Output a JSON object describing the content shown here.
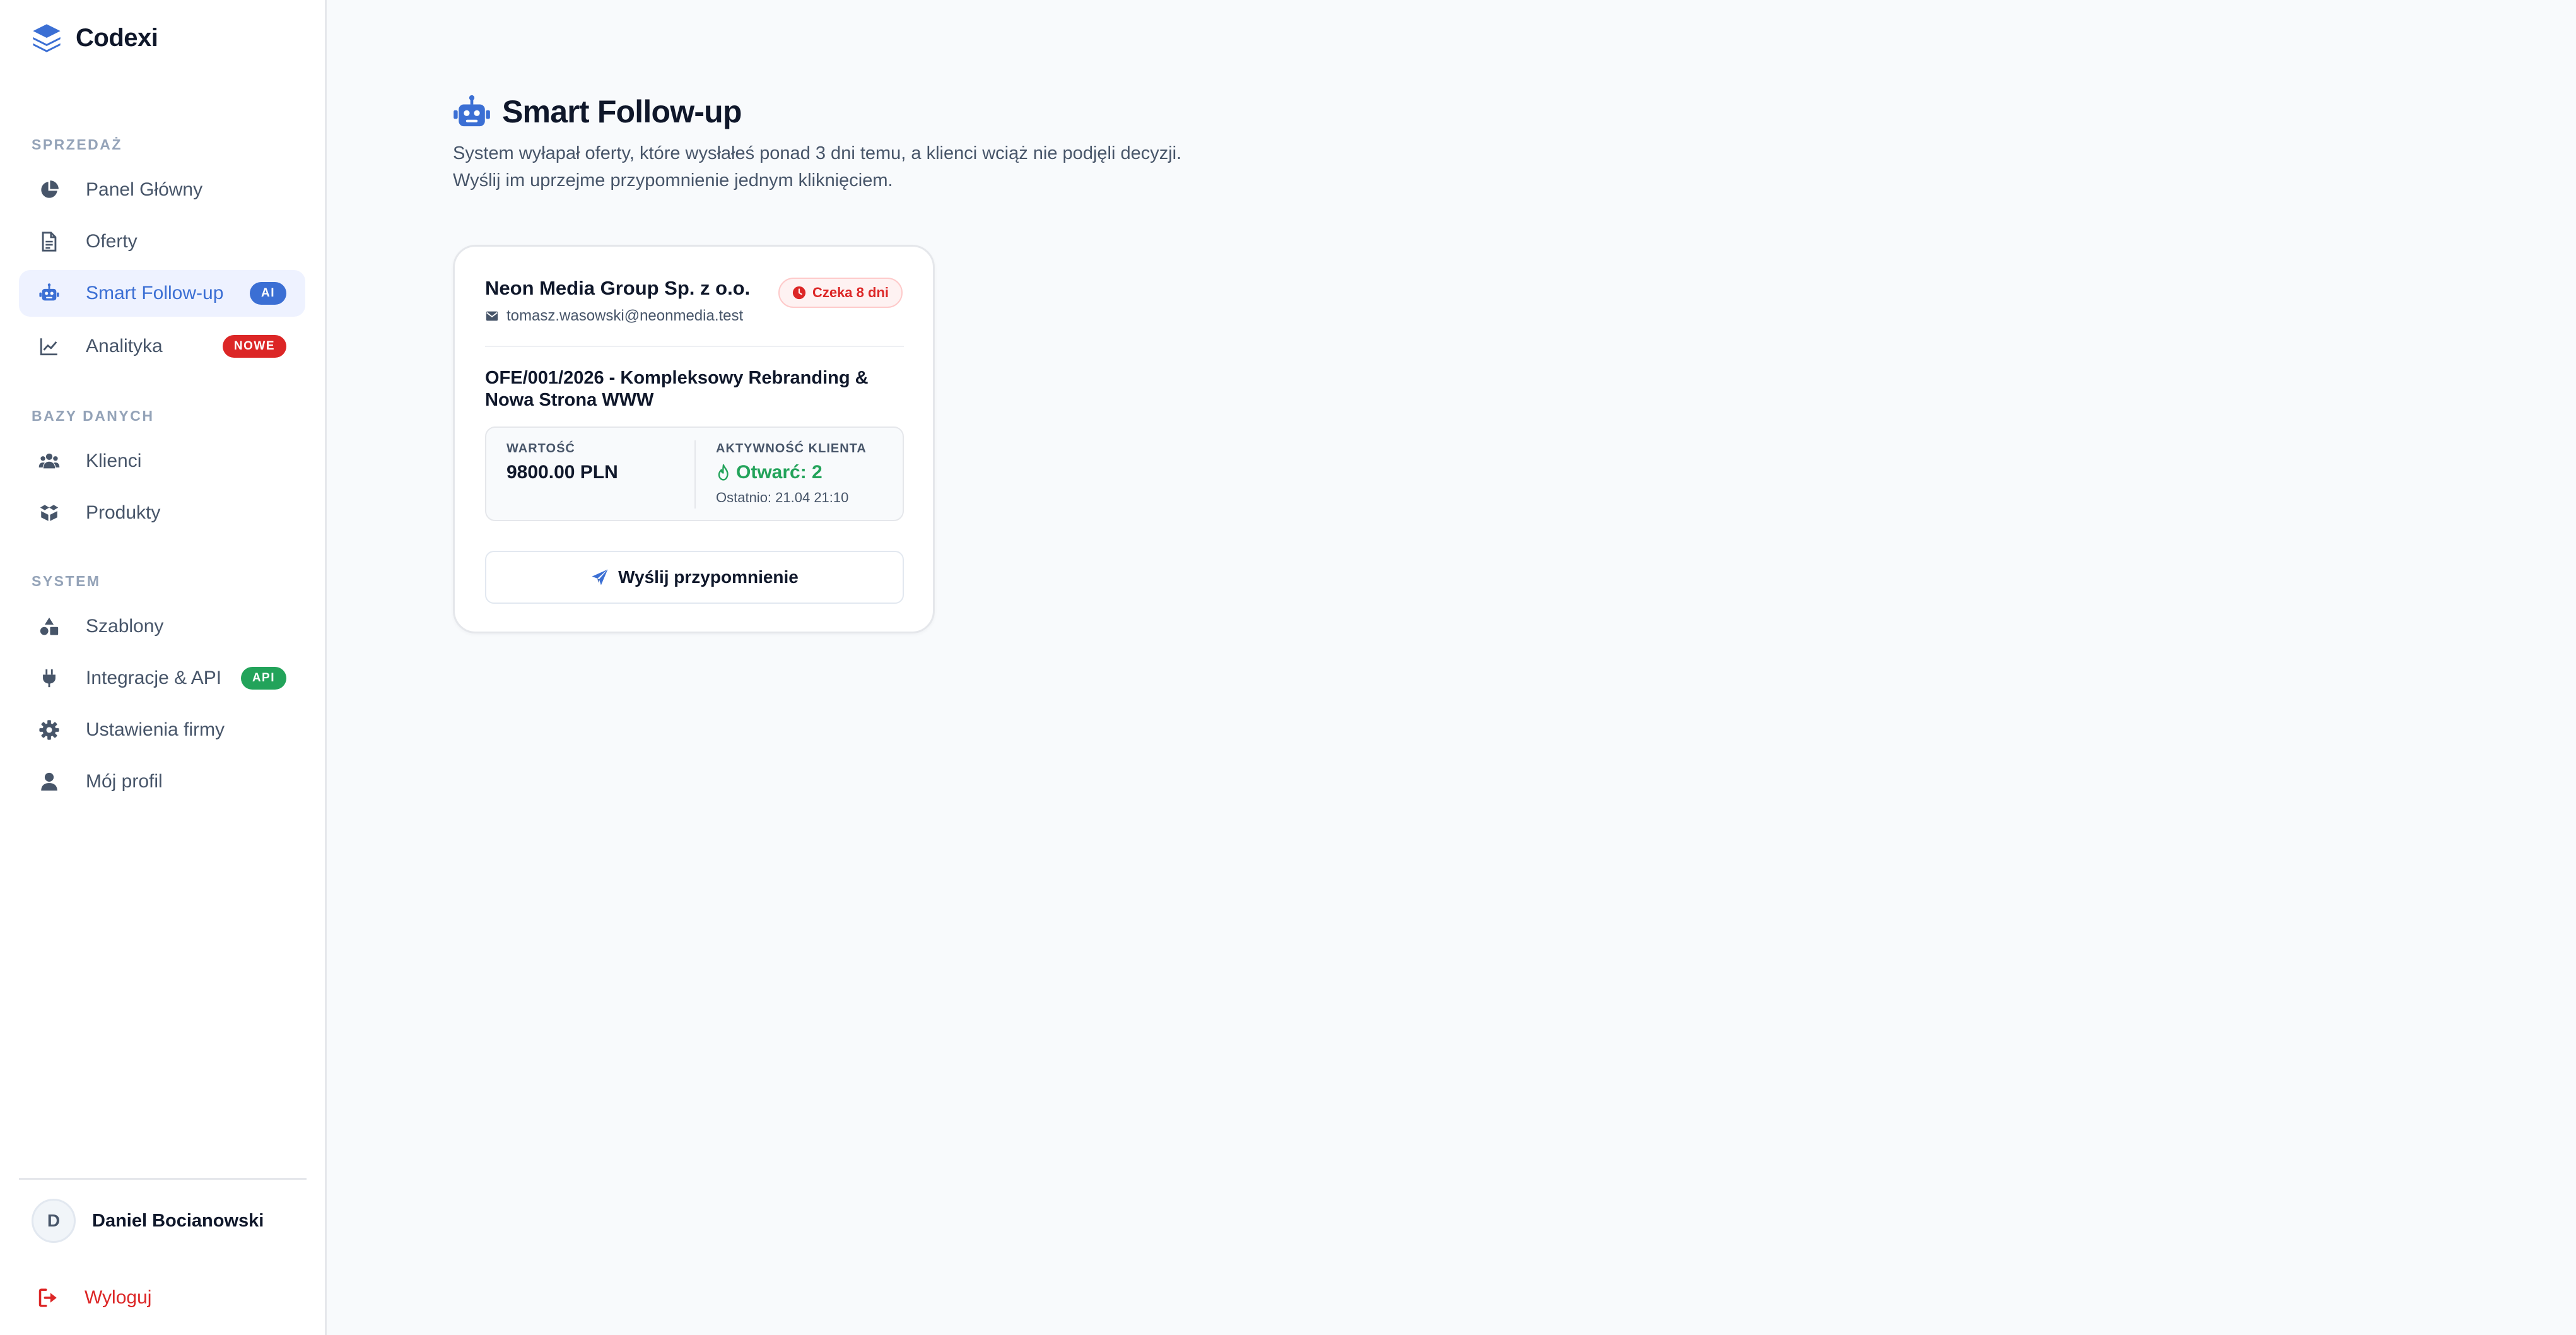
{
  "brand": {
    "name": "Codexi",
    "logo_icon": "layers-icon"
  },
  "colors": {
    "accent": "#3b6fd4",
    "active_bg": "#eef2ff",
    "danger": "#dc2626",
    "success": "#22a35a",
    "text": "#0f172a",
    "muted": "#475569"
  },
  "sidebar": {
    "sections": [
      {
        "label": "SPRZEDAŻ"
      },
      {
        "label": "BAZY DANYCH"
      },
      {
        "label": "SYSTEM"
      }
    ],
    "items": [
      {
        "label": "Panel Główny",
        "icon": "pie-chart-icon",
        "active": false
      },
      {
        "label": "Oferty",
        "icon": "document-icon",
        "active": false
      },
      {
        "label": "Smart Follow-up",
        "icon": "robot-icon",
        "active": true,
        "badge": "AI"
      },
      {
        "label": "Analityka",
        "icon": "line-chart-icon",
        "active": false,
        "badge": "NOWE"
      },
      {
        "label": "Klienci",
        "icon": "users-icon",
        "active": false
      },
      {
        "label": "Produkty",
        "icon": "box-icon",
        "active": false
      },
      {
        "label": "Szablony",
        "icon": "shapes-icon",
        "active": false
      },
      {
        "label": "Integracje & API",
        "icon": "plug-icon",
        "active": false,
        "badge": "API"
      },
      {
        "label": "Ustawienia firmy",
        "icon": "gear-icon",
        "active": false
      },
      {
        "label": "Mój profil",
        "icon": "user-icon",
        "active": false
      }
    ],
    "user": {
      "initial": "D",
      "name": "Daniel Bocianowski"
    },
    "logout_label": "Wyloguj"
  },
  "main": {
    "title": "Smart Follow-up",
    "title_icon": "robot-icon",
    "description_line1": "System wyłapał oferty, które wysłałeś ponad 3 dni temu, a klienci wciąż nie podjęli decyzji.",
    "description_line2": "Wyślij im uprzejme przypomnienie jednym kliknięciem.",
    "cards": [
      {
        "client_name": "Neon Media Group Sp. z o.o.",
        "email": "tomasz.wasowski@neonmedia.test",
        "wait_badge": "Czeka 8 dni",
        "offer_title": "OFE/001/2026 - Kompleksowy Rebranding & Nowa Strona WWW",
        "value_label": "WARTOŚĆ",
        "value": "9800.00 PLN",
        "activity_label": "AKTYWNOŚĆ KLIENTA",
        "opens": "Otwarć: 2",
        "last_activity": "Ostatnio: 21.04 21:10",
        "button_label": "Wyślij przypomnienie"
      }
    ]
  }
}
